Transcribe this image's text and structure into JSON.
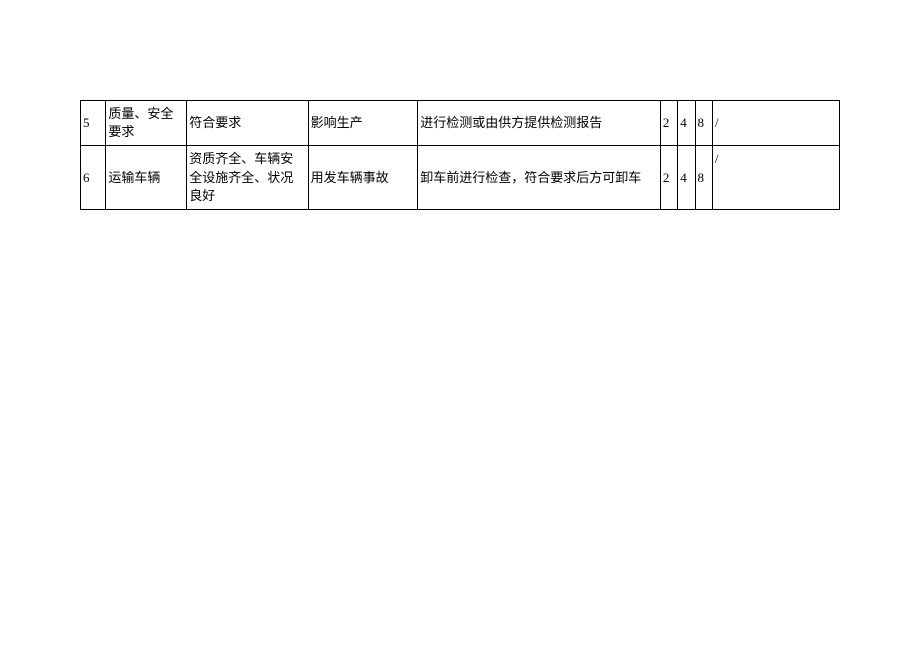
{
  "table": {
    "rows": [
      {
        "num": "5",
        "item": "质量、安全要求",
        "requirement": "符合要求",
        "risk": "影响生产",
        "measure": "进行检测或由供方提供检测报告",
        "score1": "2",
        "score2": "4",
        "score3": "8",
        "result": "/"
      },
      {
        "num": "6",
        "item": "运输车辆",
        "requirement": "资质齐全、车辆安全设施齐全、状况良好",
        "risk": "用发车辆事故",
        "measure": "卸车前进行检查，符合要求后方可卸车",
        "score1": "2",
        "score2": "4",
        "score3": "8",
        "result": "/"
      }
    ]
  }
}
